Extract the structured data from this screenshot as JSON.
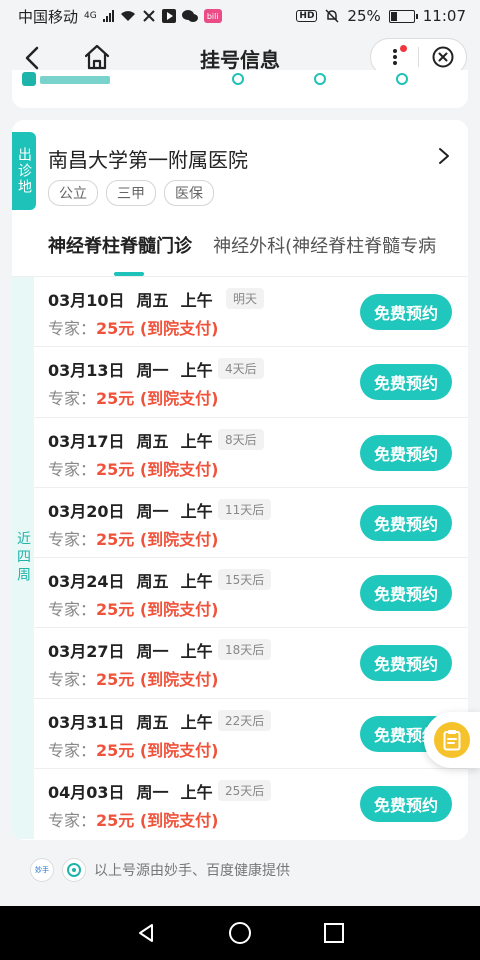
{
  "status_bar": {
    "carrier": "中国移动",
    "network": "4G",
    "app_badge": "bili",
    "hd_label": "HD",
    "battery_percent": "25%",
    "battery_level": 0.25,
    "time": "11:07"
  },
  "nav": {
    "title": "挂号信息"
  },
  "hospital": {
    "region_tag": "出诊地",
    "name": "南昌大学第一附属医院",
    "tags": [
      "公立",
      "三甲",
      "医保"
    ]
  },
  "tabs": [
    {
      "label": "神经脊柱脊髓门诊",
      "active": true
    },
    {
      "label": "神经外科(神经脊柱脊髓专病",
      "active": false
    }
  ],
  "side_label": "近四周",
  "slots": [
    {
      "date": "03月10日",
      "weekday": "周五",
      "period": "上午",
      "relative": "明天",
      "type_label": "专家：",
      "price": "25元 (到院支付)",
      "button": "免费预约"
    },
    {
      "date": "03月13日",
      "weekday": "周一",
      "period": "上午",
      "relative": "4天后",
      "type_label": "专家：",
      "price": "25元 (到院支付)",
      "button": "免费预约"
    },
    {
      "date": "03月17日",
      "weekday": "周五",
      "period": "上午",
      "relative": "8天后",
      "type_label": "专家：",
      "price": "25元 (到院支付)",
      "button": "免费预约"
    },
    {
      "date": "03月20日",
      "weekday": "周一",
      "period": "上午",
      "relative": "11天后",
      "type_label": "专家：",
      "price": "25元 (到院支付)",
      "button": "免费预约"
    },
    {
      "date": "03月24日",
      "weekday": "周五",
      "period": "上午",
      "relative": "15天后",
      "type_label": "专家：",
      "price": "25元 (到院支付)",
      "button": "免费预约"
    },
    {
      "date": "03月27日",
      "weekday": "周一",
      "period": "上午",
      "relative": "18天后",
      "type_label": "专家：",
      "price": "25元 (到院支付)",
      "button": "免费预约"
    },
    {
      "date": "03月31日",
      "weekday": "周五",
      "period": "上午",
      "relative": "22天后",
      "type_label": "专家：",
      "price": "25元 (到院支付)",
      "button": "免费预约"
    },
    {
      "date": "04月03日",
      "weekday": "周一",
      "period": "上午",
      "relative": "25天后",
      "type_label": "专家：",
      "price": "25元 (到院支付)",
      "button": "免费预约"
    }
  ],
  "footer": {
    "source_text": "以上号源由妙手、百度健康提供",
    "logo1_text": "妙手"
  },
  "colors": {
    "accent": "#20c7bd",
    "price": "#f0533c",
    "float_button": "#f6c22b"
  }
}
